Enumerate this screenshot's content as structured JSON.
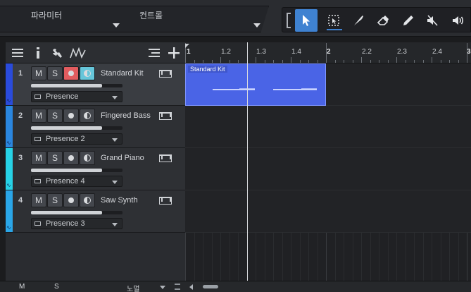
{
  "topbar": {
    "parameter_label": "파라미터",
    "control_label": "컨트롤",
    "tools": [
      {
        "name": "arrow-tool-icon",
        "active": true
      },
      {
        "name": "range-tool-icon",
        "active": false
      },
      {
        "name": "split-tool-icon",
        "active": false
      },
      {
        "name": "eraser-tool-icon",
        "active": false
      },
      {
        "name": "paint-tool-icon",
        "active": false
      },
      {
        "name": "mute-tool-icon",
        "active": false
      },
      {
        "name": "listen-tool-icon",
        "active": false
      }
    ]
  },
  "ruler": {
    "labels": [
      "1",
      "1.2",
      "1.3",
      "1.4",
      "2",
      "2.2",
      "2.3",
      "2.4",
      "3"
    ]
  },
  "tracks": [
    {
      "number": "1",
      "name": "Standard Kit",
      "instrument": "Presence",
      "color": "#2a4bdb",
      "muted": false,
      "soloed": false,
      "record": true,
      "monitor": true,
      "volume": 0.78,
      "selected": true
    },
    {
      "number": "2",
      "name": "Fingered Bass",
      "instrument": "Presence 2",
      "color": "#2a86df",
      "muted": false,
      "soloed": false,
      "record": false,
      "monitor": false,
      "volume": 0.78,
      "selected": false
    },
    {
      "number": "3",
      "name": "Grand Piano",
      "instrument": "Presence 4",
      "color": "#27d2e6",
      "muted": false,
      "soloed": false,
      "record": false,
      "monitor": false,
      "volume": 0.78,
      "selected": false
    },
    {
      "number": "4",
      "name": "Saw Synth",
      "instrument": "Presence 3",
      "color": "#2aa6e8",
      "muted": false,
      "soloed": false,
      "record": false,
      "monitor": false,
      "volume": 0.78,
      "selected": false
    }
  ],
  "track_buttons": {
    "mute": "M",
    "solo": "S"
  },
  "event": {
    "name": "Standard Kit"
  },
  "bottombar": {
    "mute": "M",
    "solo": "S",
    "normal": "노멀"
  }
}
